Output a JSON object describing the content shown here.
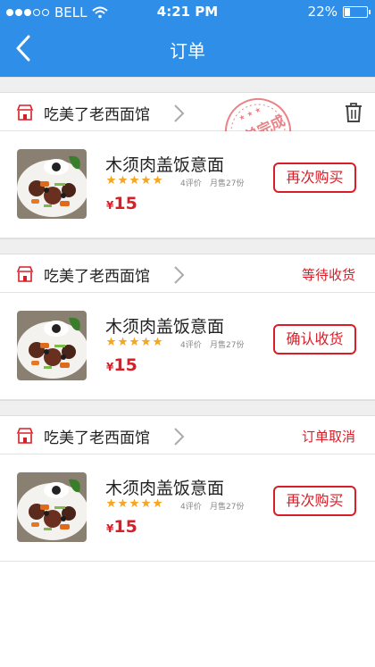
{
  "status_bar": {
    "carrier": "BELL",
    "time": "4:21 PM",
    "battery": "22%",
    "battery_level": 0.22
  },
  "nav": {
    "title": "订单"
  },
  "orders": [
    {
      "store": "吃美了老西面馆",
      "status": "",
      "stamp": "订单完成",
      "item": {
        "name": "木须肉盖饭意面",
        "rating": 5,
        "reviews": "4评价",
        "sales": "月售27份",
        "currency": "¥",
        "price": "15"
      },
      "action": "再次购买"
    },
    {
      "store": "吃美了老西面馆",
      "status": "等待收货",
      "item": {
        "name": "木须肉盖饭意面",
        "rating": 5,
        "reviews": "4评价",
        "sales": "月售27份",
        "currency": "¥",
        "price": "15"
      },
      "action": "确认收货"
    },
    {
      "store": "吃美了老西面馆",
      "status": "订单取消",
      "item": {
        "name": "木须肉盖饭意面",
        "rating": 5,
        "reviews": "4评价",
        "sales": "月售27份",
        "currency": "¥",
        "price": "15"
      },
      "action": "再次购买"
    }
  ],
  "colors": {
    "header": "#2f8fe8",
    "accent": "#d81e27",
    "star": "#f5a623"
  }
}
